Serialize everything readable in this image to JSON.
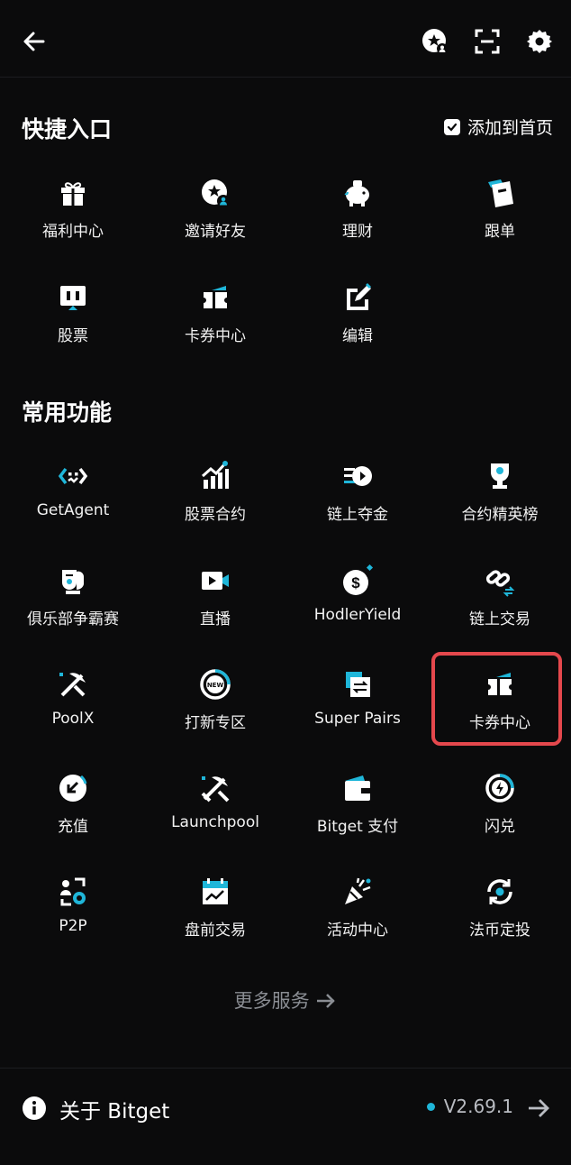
{
  "quick_access": {
    "title": "快捷入口",
    "add_to_home": "添加到首页",
    "items": [
      {
        "label": "福利中心",
        "icon": "gift-icon"
      },
      {
        "label": "邀请好友",
        "icon": "invite-friends-icon"
      },
      {
        "label": "理财",
        "icon": "piggy-bank-icon"
      },
      {
        "label": "跟单",
        "icon": "copy-trade-icon"
      },
      {
        "label": "股票",
        "icon": "stocks-icon"
      },
      {
        "label": "卡券中心",
        "icon": "coupon-icon"
      },
      {
        "label": "编辑",
        "icon": "edit-icon"
      }
    ]
  },
  "common": {
    "title": "常用功能",
    "items": [
      {
        "label": "GetAgent",
        "icon": "agent-icon"
      },
      {
        "label": "股票合约",
        "icon": "stock-futures-icon"
      },
      {
        "label": "链上夺金",
        "icon": "onchain-rush-icon"
      },
      {
        "label": "合约精英榜",
        "icon": "trophy-icon"
      },
      {
        "label": "俱乐部争霸赛",
        "icon": "club-battle-icon"
      },
      {
        "label": "直播",
        "icon": "live-video-icon"
      },
      {
        "label": "HodlerYield",
        "icon": "dollar-icon"
      },
      {
        "label": "链上交易",
        "icon": "link-exchange-icon"
      },
      {
        "label": "PoolX",
        "icon": "pickaxe-icon"
      },
      {
        "label": "打新专区",
        "icon": "new-listing-icon"
      },
      {
        "label": "Super Pairs",
        "icon": "super-pairs-icon"
      },
      {
        "label": "卡券中心",
        "icon": "coupon-icon"
      },
      {
        "label": "充值",
        "icon": "deposit-icon"
      },
      {
        "label": "Launchpool",
        "icon": "launchpool-icon"
      },
      {
        "label": "Bitget 支付",
        "icon": "wallet-icon"
      },
      {
        "label": "闪兑",
        "icon": "flash-swap-icon"
      },
      {
        "label": "P2P",
        "icon": "p2p-icon"
      },
      {
        "label": "盘前交易",
        "icon": "calendar-chart-icon"
      },
      {
        "label": "活动中心",
        "icon": "party-popper-icon"
      },
      {
        "label": "法币定投",
        "icon": "recurring-buy-icon"
      }
    ]
  },
  "more_services": "更多服务",
  "footer": {
    "about": "关于 Bitget",
    "version": "V2.69.1"
  },
  "colors": {
    "accent": "#1fb6d9",
    "highlight": "#e5484d",
    "background": "#0b0b0c"
  }
}
